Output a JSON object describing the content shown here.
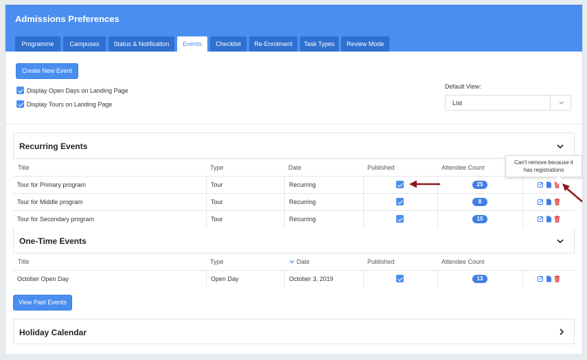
{
  "header": {
    "title": "Admissions Preferences",
    "tabs": [
      {
        "label": "Programme"
      },
      {
        "label": "Campuses"
      },
      {
        "label": "Status & Notification"
      },
      {
        "label": "Events",
        "active": true
      },
      {
        "label": "Checklist"
      },
      {
        "label": "Re-Enrolment"
      },
      {
        "label": "Task Types"
      },
      {
        "label": "Review Mode"
      }
    ]
  },
  "toolbar": {
    "create_label": "Create New Event",
    "display_open_days_label": "Display Open Days on Landing Page",
    "display_tours_label": "Display Tours on Landing Page",
    "default_view_label": "Default View:",
    "default_view_value": "List"
  },
  "recurring": {
    "title": "Recurring Events",
    "headers": {
      "title": "Title",
      "type": "Type",
      "date": "Date",
      "published": "Published",
      "attendee": "Attendee Count"
    },
    "rows": [
      {
        "title": "Tour for Primary program",
        "type": "Tour",
        "date": "Recurring",
        "count": "25"
      },
      {
        "title": "Tour for Middle program",
        "type": "Tour",
        "date": "Recurring",
        "count": "8"
      },
      {
        "title": "Tour for Secondary program",
        "type": "Tour",
        "date": "Recurring",
        "count": "15"
      }
    ]
  },
  "onetime": {
    "title": "One-Time Events",
    "headers": {
      "title": "Title",
      "type": "Type",
      "date": "Date",
      "published": "Published",
      "attendee": "Attendee Count"
    },
    "rows": [
      {
        "title": "October Open Day",
        "type": "Open Day",
        "date": "October 3, 2019",
        "count": "13"
      }
    ]
  },
  "past_events_label": "View Past Events",
  "holiday": {
    "title": "Holiday Calendar"
  },
  "tooltip": {
    "line1": "Can't remove because it",
    "line2": "has registrations"
  },
  "colors": {
    "primary": "#4a8ef0",
    "tab_dark": "#2f6fcf",
    "delete": "#e0393e",
    "arrow": "#8b1a1a"
  }
}
